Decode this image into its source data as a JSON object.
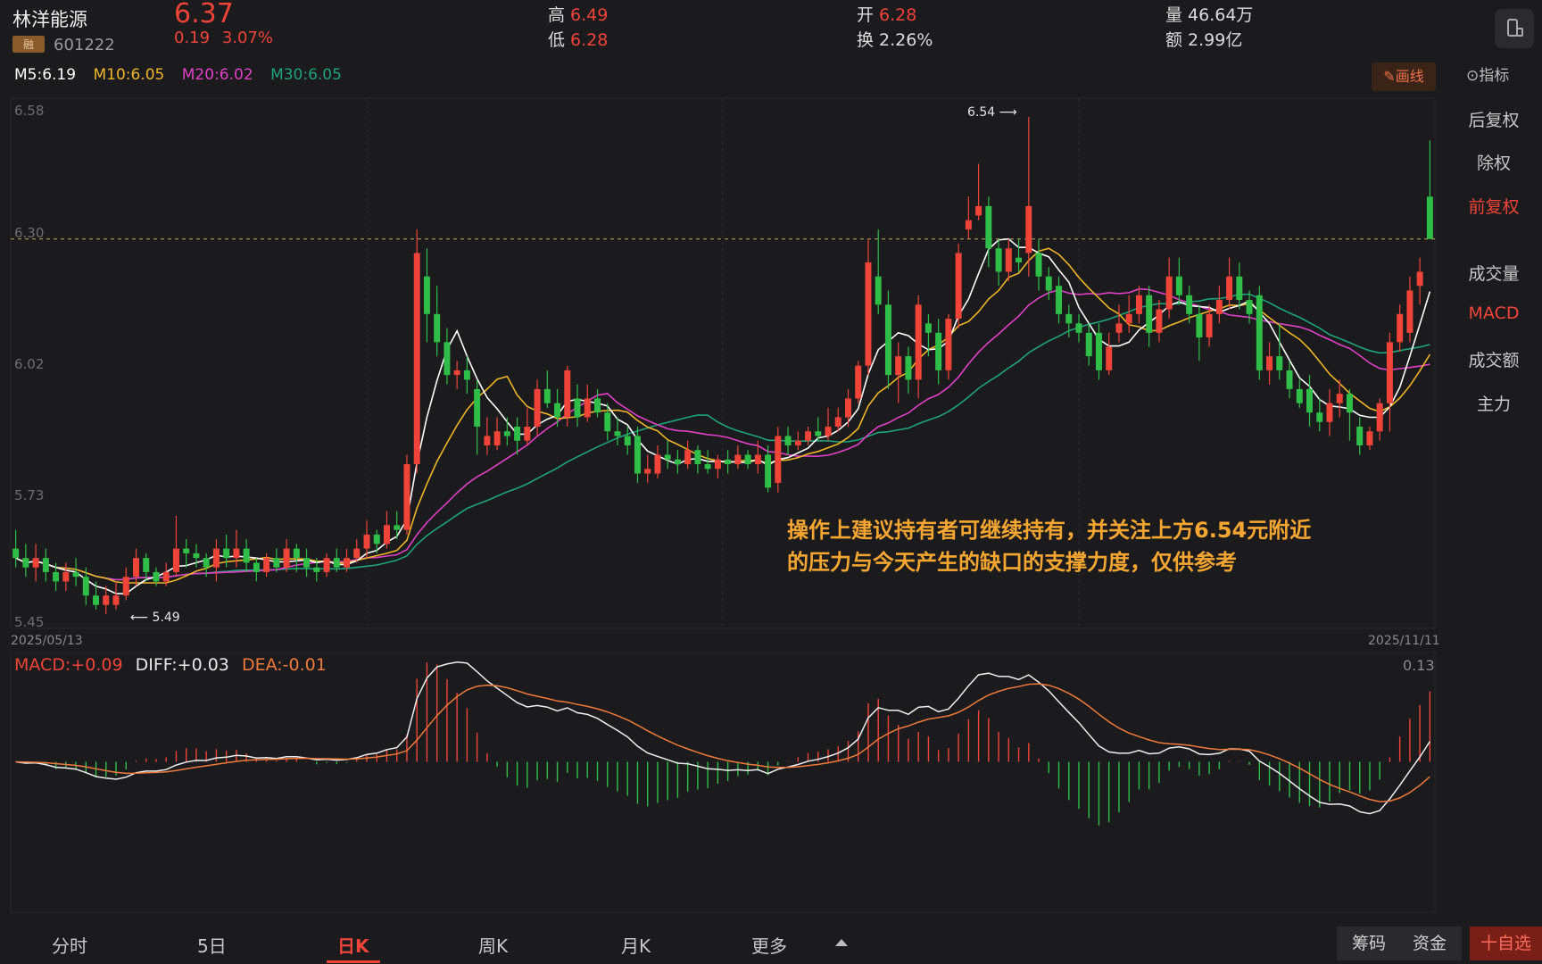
{
  "header": {
    "name": "林洋能源",
    "badge": "融",
    "code": "601222",
    "price": "6.37",
    "change": "0.19",
    "change_pct": "3.07%",
    "high_label": "高",
    "high": "6.49",
    "low_label": "低",
    "low": "6.28",
    "open_label": "开",
    "open": "6.28",
    "turnover_label": "换",
    "turnover": "2.26%",
    "volume_label": "量",
    "volume": "46.64万",
    "amount_label": "额",
    "amount": "2.99亿"
  },
  "ma": {
    "m5": "M5:6.19",
    "m10": "M10:6.05",
    "m20": "M20:6.02",
    "m30": "M30:6.05",
    "colors": {
      "m5": "#ffffff",
      "m10": "#f0b429",
      "m20": "#e040c8",
      "m30": "#1fa37a"
    }
  },
  "toolbar": {
    "draw": "✎画线",
    "indicator": "⊙指标"
  },
  "sidebar": {
    "items": [
      {
        "label": "后复权",
        "active": false
      },
      {
        "label": "除权",
        "active": false
      },
      {
        "label": "前复权",
        "active": true
      },
      {
        "label": "成交量",
        "active": false
      },
      {
        "label": "MACD",
        "active": true
      },
      {
        "label": "成交额",
        "active": false
      },
      {
        "label": "主力",
        "active": false
      }
    ]
  },
  "main_chart": {
    "y_ticks": [
      "6.58",
      "6.30",
      "6.02",
      "5.73",
      "5.45"
    ],
    "date_start": "2025/05/13",
    "date_end": "2025/11/11",
    "high_mark": "6.54",
    "low_mark": "5.49"
  },
  "macd": {
    "macd": "MACD:+0.09",
    "diff": "DIFF:+0.03",
    "dea": "DEA:-0.01",
    "max": "0.13"
  },
  "annotation": {
    "line1": "操作上建议持有者可继续持有，并关注上方6.54元附近",
    "line2": "的压力与今天产生的缺口的支撑力度，仅供参考"
  },
  "tabs": [
    {
      "label": "分时"
    },
    {
      "label": "5日"
    },
    {
      "label": "日K"
    },
    {
      "label": "周K"
    },
    {
      "label": "月K"
    },
    {
      "label": "更多"
    }
  ],
  "bottom_buttons": {
    "chips": "筹码",
    "funds": "资金",
    "add": "十自选"
  },
  "chart_data": {
    "type": "candlestick",
    "ylim": [
      5.45,
      6.58
    ],
    "up_color": "#f04438",
    "down_color": "#2fbf48",
    "candles": [
      [
        5.62,
        5.6,
        5.66,
        5.58
      ],
      [
        5.6,
        5.58,
        5.63,
        5.56
      ],
      [
        5.58,
        5.6,
        5.63,
        5.55
      ],
      [
        5.6,
        5.57,
        5.62,
        5.55
      ],
      [
        5.57,
        5.55,
        5.59,
        5.53
      ],
      [
        5.55,
        5.57,
        5.59,
        5.53
      ],
      [
        5.57,
        5.56,
        5.6,
        5.54
      ],
      [
        5.56,
        5.52,
        5.58,
        5.5
      ],
      [
        5.52,
        5.5,
        5.55,
        5.49
      ],
      [
        5.5,
        5.52,
        5.54,
        5.48
      ],
      [
        5.5,
        5.52,
        5.55,
        5.49
      ],
      [
        5.52,
        5.56,
        5.58,
        5.51
      ],
      [
        5.56,
        5.6,
        5.62,
        5.54
      ],
      [
        5.6,
        5.57,
        5.61,
        5.55
      ],
      [
        5.57,
        5.55,
        5.58,
        5.54
      ],
      [
        5.55,
        5.57,
        5.59,
        5.54
      ],
      [
        5.57,
        5.62,
        5.69,
        5.56
      ],
      [
        5.62,
        5.61,
        5.64,
        5.58
      ],
      [
        5.61,
        5.6,
        5.63,
        5.58
      ],
      [
        5.6,
        5.58,
        5.61,
        5.56
      ],
      [
        5.58,
        5.62,
        5.64,
        5.55
      ],
      [
        5.62,
        5.6,
        5.65,
        5.58
      ],
      [
        5.6,
        5.62,
        5.66,
        5.58
      ],
      [
        5.62,
        5.59,
        5.64,
        5.57
      ],
      [
        5.59,
        5.57,
        5.6,
        5.55
      ],
      [
        5.57,
        5.6,
        5.61,
        5.56
      ],
      [
        5.6,
        5.58,
        5.62,
        5.57
      ],
      [
        5.58,
        5.62,
        5.64,
        5.57
      ],
      [
        5.62,
        5.6,
        5.63,
        5.57
      ],
      [
        5.6,
        5.58,
        5.62,
        5.56
      ],
      [
        5.58,
        5.57,
        5.6,
        5.55
      ],
      [
        5.57,
        5.6,
        5.61,
        5.56
      ],
      [
        5.6,
        5.58,
        5.62,
        5.57
      ],
      [
        5.58,
        5.6,
        5.62,
        5.57
      ],
      [
        5.6,
        5.62,
        5.64,
        5.59
      ],
      [
        5.62,
        5.65,
        5.68,
        5.6
      ],
      [
        5.65,
        5.63,
        5.66,
        5.61
      ],
      [
        5.63,
        5.67,
        5.7,
        5.62
      ],
      [
        5.67,
        5.66,
        5.7,
        5.64
      ],
      [
        5.66,
        5.8,
        5.82,
        5.65
      ],
      [
        5.8,
        6.25,
        6.3,
        5.78
      ],
      [
        6.2,
        6.12,
        6.26,
        6.06
      ],
      [
        6.12,
        6.06,
        6.18,
        6.03
      ],
      [
        6.06,
        5.99,
        6.09,
        5.97
      ],
      [
        5.99,
        6.0,
        6.02,
        5.96
      ],
      [
        6.0,
        5.98,
        6.03,
        5.95
      ],
      [
        5.96,
        5.88,
        5.98,
        5.82
      ],
      [
        5.84,
        5.86,
        5.9,
        5.82
      ],
      [
        5.84,
        5.87,
        5.9,
        5.83
      ],
      [
        5.87,
        5.86,
        5.9,
        5.84
      ],
      [
        5.88,
        5.85,
        5.9,
        5.82
      ],
      [
        5.85,
        5.88,
        5.92,
        5.84
      ],
      [
        5.88,
        5.96,
        5.98,
        5.86
      ],
      [
        5.96,
        5.93,
        6.0,
        5.92
      ],
      [
        5.93,
        5.9,
        5.96,
        5.88
      ],
      [
        5.9,
        6.0,
        6.01,
        5.88
      ],
      [
        5.94,
        5.9,
        5.97,
        5.88
      ],
      [
        5.9,
        5.94,
        5.97,
        5.89
      ],
      [
        5.94,
        5.91,
        5.96,
        5.9
      ],
      [
        5.91,
        5.87,
        5.93,
        5.85
      ],
      [
        5.87,
        5.86,
        5.9,
        5.84
      ],
      [
        5.86,
        5.84,
        5.88,
        5.82
      ],
      [
        5.86,
        5.78,
        5.88,
        5.76
      ],
      [
        5.78,
        5.79,
        5.82,
        5.76
      ],
      [
        5.78,
        5.82,
        5.84,
        5.77
      ],
      [
        5.82,
        5.81,
        5.85,
        5.79
      ],
      [
        5.81,
        5.8,
        5.83,
        5.78
      ],
      [
        5.8,
        5.83,
        5.85,
        5.79
      ],
      [
        5.83,
        5.8,
        5.84,
        5.78
      ],
      [
        5.8,
        5.79,
        5.83,
        5.78
      ],
      [
        5.79,
        5.81,
        5.82,
        5.77
      ],
      [
        5.81,
        5.8,
        5.83,
        5.78
      ],
      [
        5.8,
        5.82,
        5.84,
        5.79
      ],
      [
        5.82,
        5.8,
        5.83,
        5.79
      ],
      [
        5.8,
        5.82,
        5.85,
        5.78
      ],
      [
        5.82,
        5.75,
        5.84,
        5.74
      ],
      [
        5.76,
        5.86,
        5.88,
        5.74
      ],
      [
        5.86,
        5.84,
        5.88,
        5.82
      ],
      [
        5.84,
        5.85,
        5.87,
        5.83
      ],
      [
        5.85,
        5.87,
        5.88,
        5.84
      ],
      [
        5.87,
        5.86,
        5.9,
        5.85
      ],
      [
        5.86,
        5.88,
        5.92,
        5.85
      ],
      [
        5.88,
        5.9,
        5.92,
        5.87
      ],
      [
        5.9,
        5.94,
        5.96,
        5.88
      ],
      [
        5.94,
        6.01,
        6.02,
        5.93
      ],
      [
        6.01,
        6.23,
        6.28,
        5.99
      ],
      [
        6.2,
        6.14,
        6.3,
        6.12
      ],
      [
        6.14,
        5.99,
        6.17,
        5.96
      ],
      [
        5.99,
        6.03,
        6.06,
        5.93
      ],
      [
        6.03,
        5.98,
        6.05,
        5.95
      ],
      [
        5.98,
        6.14,
        6.16,
        5.94
      ],
      [
        6.1,
        6.08,
        6.12,
        6.03
      ],
      [
        6.08,
        6.0,
        6.11,
        5.97
      ],
      [
        6.0,
        6.11,
        6.12,
        5.98
      ],
      [
        6.11,
        6.25,
        6.27,
        6.09
      ],
      [
        6.3,
        6.32,
        6.37,
        6.28
      ],
      [
        6.33,
        6.35,
        6.44,
        6.32
      ],
      [
        6.35,
        6.26,
        6.37,
        6.22
      ],
      [
        6.26,
        6.21,
        6.28,
        6.18
      ],
      [
        6.21,
        6.26,
        6.28,
        6.19
      ],
      [
        6.24,
        6.23,
        6.28,
        6.21
      ],
      [
        6.25,
        6.35,
        6.54,
        6.2
      ],
      [
        6.25,
        6.2,
        6.28,
        6.17
      ],
      [
        6.2,
        6.17,
        6.22,
        6.15
      ],
      [
        6.18,
        6.12,
        6.2,
        6.1
      ],
      [
        6.12,
        6.1,
        6.14,
        6.07
      ],
      [
        6.1,
        6.08,
        6.12,
        6.06
      ],
      [
        6.08,
        6.03,
        6.1,
        6.01
      ],
      [
        6.08,
        6.0,
        6.1,
        5.98
      ],
      [
        6.0,
        6.05,
        6.08,
        5.99
      ],
      [
        6.08,
        6.1,
        6.14,
        6.06
      ],
      [
        6.1,
        6.12,
        6.16,
        6.08
      ],
      [
        6.12,
        6.16,
        6.18,
        6.1
      ],
      [
        6.16,
        6.08,
        6.18,
        6.05
      ],
      [
        6.08,
        6.13,
        6.15,
        6.06
      ],
      [
        6.13,
        6.2,
        6.24,
        6.11
      ],
      [
        6.2,
        6.16,
        6.24,
        6.14
      ],
      [
        6.16,
        6.12,
        6.18,
        6.1
      ],
      [
        6.12,
        6.07,
        6.14,
        6.02
      ],
      [
        6.07,
        6.12,
        6.14,
        6.05
      ],
      [
        6.12,
        6.15,
        6.18,
        6.1
      ],
      [
        6.15,
        6.2,
        6.24,
        6.13
      ],
      [
        6.2,
        6.15,
        6.23,
        6.13
      ],
      [
        6.15,
        6.12,
        6.17,
        6.1
      ],
      [
        6.16,
        6.0,
        6.18,
        5.98
      ],
      [
        6.0,
        6.03,
        6.06,
        5.97
      ],
      [
        6.03,
        6.0,
        6.1,
        5.98
      ],
      [
        6.0,
        5.96,
        6.02,
        5.94
      ],
      [
        5.96,
        5.93,
        5.98,
        5.92
      ],
      [
        5.96,
        5.91,
        5.99,
        5.88
      ],
      [
        5.91,
        5.89,
        5.94,
        5.87
      ],
      [
        5.89,
        5.93,
        5.96,
        5.86
      ],
      [
        5.93,
        5.95,
        5.98,
        5.9
      ],
      [
        5.95,
        5.91,
        5.96,
        5.85
      ],
      [
        5.88,
        5.84,
        5.9,
        5.82
      ],
      [
        5.84,
        5.87,
        5.88,
        5.83
      ],
      [
        5.87,
        5.93,
        5.94,
        5.85
      ],
      [
        5.93,
        6.06,
        6.08,
        5.87
      ],
      [
        6.06,
        6.12,
        6.14,
        6.04
      ],
      [
        6.08,
        6.17,
        6.2,
        6.06
      ],
      [
        6.18,
        6.21,
        6.24,
        6.14
      ],
      [
        6.37,
        6.28,
        6.49,
        6.28
      ]
    ]
  }
}
